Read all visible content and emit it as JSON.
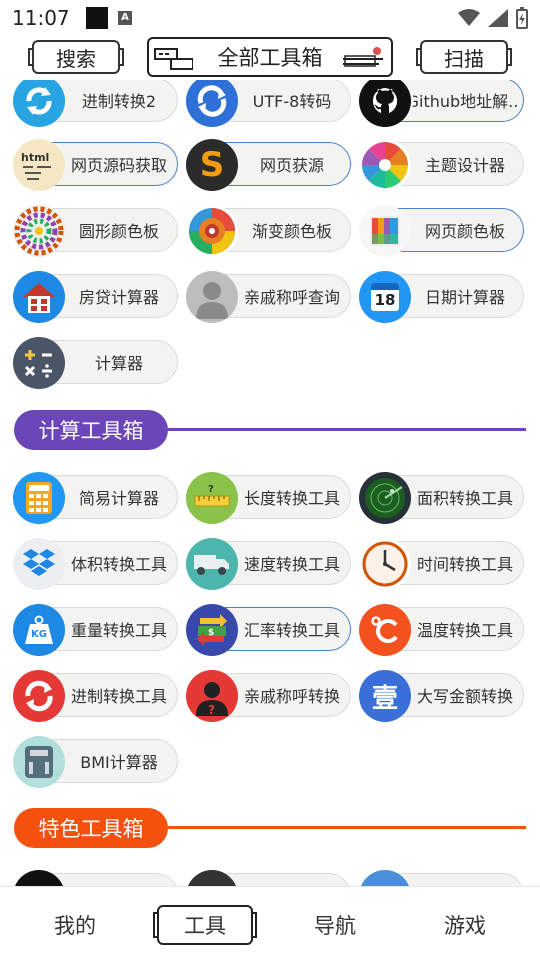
{
  "status_bar": {
    "time": "11:07",
    "notif_icon": "A"
  },
  "header": {
    "search_label": "搜索",
    "title": "全部工具箱",
    "scan_label": "扫描"
  },
  "tools_top": [
    {
      "label": "进制转换2",
      "icon": "refresh-icon"
    },
    {
      "label": "UTF-8转码",
      "icon": "sync-icon"
    },
    {
      "label": "Github地址解...",
      "icon": "github-icon"
    },
    {
      "label": "网页源码获取",
      "icon": "html-icon"
    },
    {
      "label": "网页获源",
      "icon": "s-logo-icon"
    },
    {
      "label": "主题设计器",
      "icon": "color-wheel-icon"
    },
    {
      "label": "圆形颜色板",
      "icon": "color-circle-icon"
    },
    {
      "label": "渐变颜色板",
      "icon": "gradient-wheel-icon"
    },
    {
      "label": "网页颜色板",
      "icon": "palette-grid-icon"
    },
    {
      "label": "房贷计算器",
      "icon": "house-icon"
    },
    {
      "label": "亲戚称呼查询",
      "icon": "person-icon"
    },
    {
      "label": "日期计算器",
      "icon": "calendar-icon",
      "badge": "18"
    },
    {
      "label": "计算器",
      "icon": "calculator-ops-icon"
    }
  ],
  "section_calc": {
    "title": "计算工具箱",
    "color": "#6a46b8"
  },
  "tools_calc": [
    {
      "label": "简易计算器",
      "icon": "calculator-icon"
    },
    {
      "label": "长度转换工具",
      "icon": "ruler-icon"
    },
    {
      "label": "面积转换工具",
      "icon": "radar-icon"
    },
    {
      "label": "体积转换工具",
      "icon": "dropbox-icon"
    },
    {
      "label": "速度转换工具",
      "icon": "truck-icon"
    },
    {
      "label": "时间转换工具",
      "icon": "clock-icon"
    },
    {
      "label": "重量转换工具",
      "icon": "weight-icon",
      "badge": "KG"
    },
    {
      "label": "汇率转换工具",
      "icon": "exchange-icon"
    },
    {
      "label": "温度转换工具",
      "icon": "celsius-icon"
    },
    {
      "label": "进制转换工具",
      "icon": "convert-icon"
    },
    {
      "label": "亲戚称呼转换",
      "icon": "question-person-icon"
    },
    {
      "label": "大写金额转换",
      "icon": "yi-icon",
      "badge": "壹"
    },
    {
      "label": "BMI计算器",
      "icon": "scale-icon"
    }
  ],
  "section_feature": {
    "title": "特色工具箱",
    "color": "#f4500e"
  },
  "bottom_nav": [
    "我的",
    "工具",
    "导航",
    "游戏"
  ]
}
